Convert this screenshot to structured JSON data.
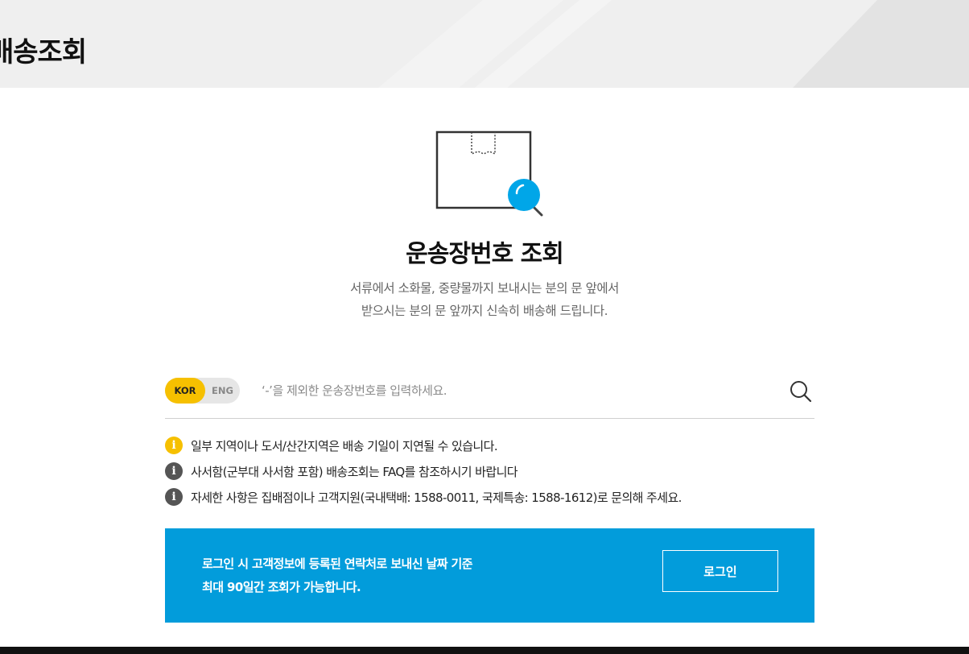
{
  "header": {
    "title": "배송조회"
  },
  "main": {
    "title": "운송장번호 조회",
    "description_lines": [
      "서류에서 소화물, 중량물까지 보내시는 분의 문 앞에서",
      "받으시는 분의 문 앞까지 신속히 배송해 드립니다."
    ]
  },
  "search": {
    "lang_kor": "KOR",
    "lang_eng": "ENG",
    "selected_lang": "KOR",
    "placeholder": "‘-’을 제외한 운송장번호를 입력하세요.",
    "value": ""
  },
  "notices": [
    {
      "icon": "info-icon",
      "text": "일부 지역이나 도서/산간지역은 배송 기일이 지연될 수 있습니다."
    },
    {
      "icon": "info-icon",
      "text": "사서함(군부대 사서함 포함) 배송조회는 FAQ를 참조하시기 바랍니다"
    },
    {
      "icon": "info-icon",
      "text": "자세한 사항은 집배점이나 고객지원(국내택배: 1588-0011, 국제특송: 1588-1612)로 문의해 주세요."
    }
  ],
  "login_banner": {
    "line1": "로그인 시 고객정보에 등록된 연락처로 보내신 날짜 기준",
    "line2": "최대 90일간 조회가 가능합니다.",
    "button_label": "로그인"
  },
  "colors": {
    "accent_yellow": "#f6c000",
    "banner_blue": "#029cdb",
    "magnifier_blue": "#00a6e8",
    "header_bg": "#efefef"
  }
}
